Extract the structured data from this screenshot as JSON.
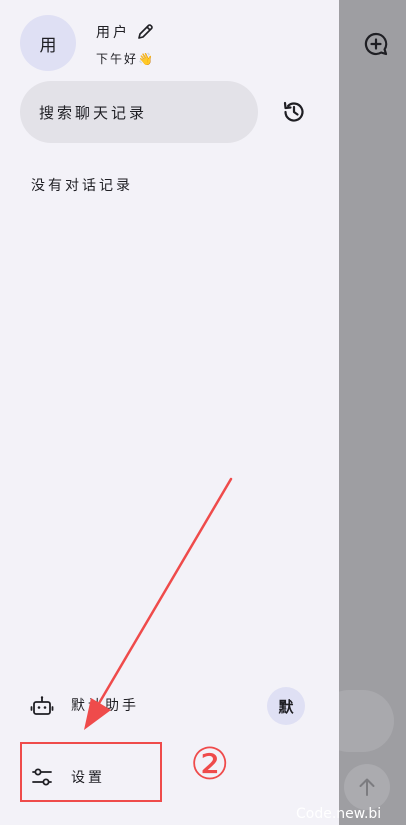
{
  "background": {
    "new_chat_icon": "message-plus-icon",
    "send_icon": "arrow-up-icon"
  },
  "drawer": {
    "avatar_text": "用",
    "user_name": "用户",
    "edit_icon": "pencil-icon",
    "greeting": "下午好👋",
    "search_placeholder": "搜索聊天记录",
    "history_icon": "history-icon",
    "empty_message": "没有对话记录",
    "assistant": {
      "icon": "robot-icon",
      "label": "默认助手",
      "badge": "默"
    },
    "settings": {
      "icon": "sliders-icon",
      "label": "设置"
    }
  },
  "annotation": {
    "step_marker": "②",
    "color": "#ef4b4b"
  },
  "watermark": "Code.new.bi"
}
